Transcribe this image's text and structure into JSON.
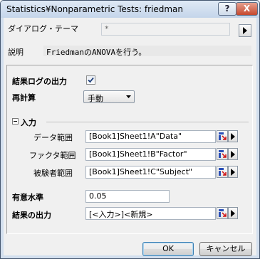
{
  "window": {
    "title": "Statistics¥Nonparametric Tests: friedman",
    "help_label": "?",
    "close_label": "X"
  },
  "theme": {
    "label": "ダイアログ・テーマ",
    "value": "*"
  },
  "description": {
    "label": "説明",
    "text": "FriedmanのANOVAを行う。"
  },
  "log_output": {
    "label": "結果ログの出力",
    "checked": true
  },
  "recalculate": {
    "label": "再計算",
    "selected": "手動"
  },
  "input_section": {
    "title": "入力",
    "rows": [
      {
        "label": "データ範囲",
        "value": "[Book1]Sheet1!A\"Data\""
      },
      {
        "label": "ファクタ範囲",
        "value": "[Book1]Sheet1!B\"Factor\""
      },
      {
        "label": "被験者範囲",
        "value": "[Book1]Sheet1!C\"Subject\""
      }
    ]
  },
  "significance": {
    "label": "有意水準",
    "value": "0.05"
  },
  "output": {
    "label": "結果の出力",
    "value": "[<入力>]<新規>"
  },
  "buttons": {
    "ok": "OK",
    "cancel": "キャンセル"
  }
}
